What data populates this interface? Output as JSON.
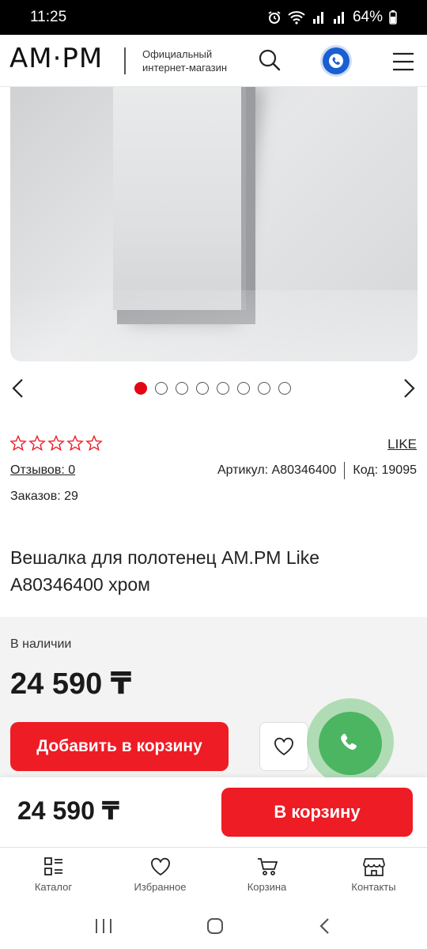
{
  "status_bar": {
    "time": "11:25",
    "battery": "64%"
  },
  "header": {
    "logo": "AM·PM",
    "tagline_line1": "Официальный",
    "tagline_line2": "интернет-магазин"
  },
  "carousel": {
    "total_slides": 8,
    "active_index": 0
  },
  "product": {
    "rating_stars": 0,
    "rating_max": 5,
    "brand": "LIKE",
    "reviews": "Отзывов: 0",
    "article": "Артикул: A80346400",
    "code": "Код: 19095",
    "orders": "Заказов: 29",
    "title": "Вешалка для полотенец AM.PM Like A80346400 хром"
  },
  "purchase": {
    "stock": "В наличии",
    "price": "24 590 ₸",
    "add_to_cart": "Добавить в корзину"
  },
  "sticky_bar": {
    "price": "24 590 ₸",
    "to_cart": "В корзину"
  },
  "bottom_nav": [
    {
      "label": "Каталог",
      "icon": "catalog-icon"
    },
    {
      "label": "Избранное",
      "icon": "heart-icon"
    },
    {
      "label": "Корзина",
      "icon": "cart-icon"
    },
    {
      "label": "Контакты",
      "icon": "store-icon"
    }
  ],
  "colors": {
    "accent": "#ee1c25",
    "call_green": "#4bb562",
    "header_phone_blue": "#1a5fd1"
  }
}
